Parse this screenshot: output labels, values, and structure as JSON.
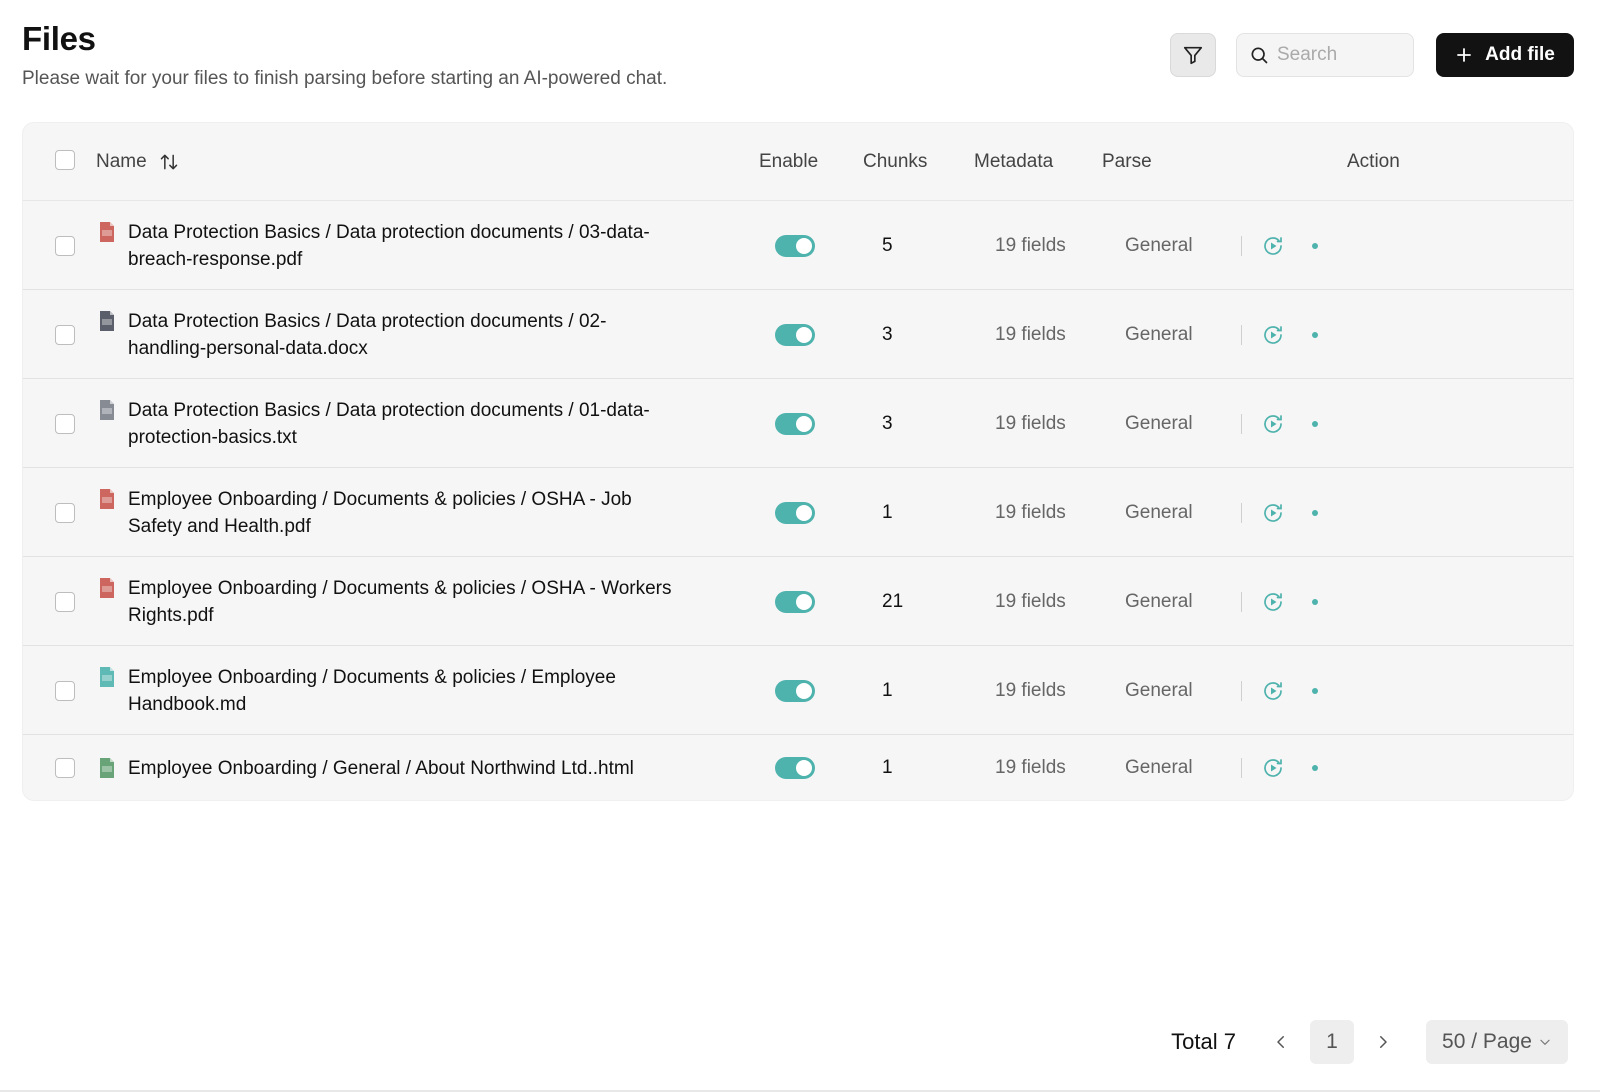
{
  "header": {
    "title": "Files",
    "subtitle": "Please wait for your files to finish parsing before starting an AI-powered chat."
  },
  "toolbar": {
    "filter_icon": "filter-icon",
    "search_placeholder": "Search",
    "add_label": "Add file"
  },
  "table": {
    "columns": {
      "name": "Name",
      "enable": "Enable",
      "chunks": "Chunks",
      "metadata": "Metadata",
      "parse": "Parse",
      "action": "Action"
    },
    "rows": [
      {
        "name_line1": "Data Protection Basics / Data protection documents / 03-data-",
        "name_line2": "breach-response.pdf",
        "type": "pdf",
        "enabled": true,
        "chunks": "5",
        "metadata": "19 fields",
        "parse": "General"
      },
      {
        "name_line1": "Data Protection Basics / Data protection documents / 02-",
        "name_line2": "handling-personal-data.docx",
        "type": "docx",
        "enabled": true,
        "chunks": "3",
        "metadata": "19 fields",
        "parse": "General"
      },
      {
        "name_line1": "Data Protection Basics / Data protection documents / 01-data-",
        "name_line2": "protection-basics.txt",
        "type": "txt",
        "enabled": true,
        "chunks": "3",
        "metadata": "19 fields",
        "parse": "General"
      },
      {
        "name_line1": "Employee Onboarding / Documents & policies / OSHA - Job",
        "name_line2": "Safety and Health.pdf",
        "type": "pdf",
        "enabled": true,
        "chunks": "1",
        "metadata": "19 fields",
        "parse": "General"
      },
      {
        "name_line1": "Employee Onboarding / Documents & policies / OSHA - Workers",
        "name_line2": "Rights.pdf",
        "type": "pdf",
        "enabled": true,
        "chunks": "21",
        "metadata": "19 fields",
        "parse": "General"
      },
      {
        "name_line1": "Employee Onboarding / Documents & policies / Employee",
        "name_line2": "Handbook.md",
        "type": "md",
        "enabled": true,
        "chunks": "1",
        "metadata": "19 fields",
        "parse": "General"
      },
      {
        "name_line1": "Employee Onboarding / General / About Northwind Ltd..html",
        "name_line2": "",
        "type": "html",
        "enabled": true,
        "chunks": "1",
        "metadata": "19 fields",
        "parse": "General"
      }
    ]
  },
  "pagination": {
    "total": "Total 7",
    "current_page": "1",
    "page_size": "50 / Page"
  },
  "colors": {
    "accent": "#4fb3ad",
    "pdf": "#c9574f",
    "docx": "#4a4f5c",
    "txt": "#7a7f8a",
    "md": "#4fb3ad",
    "html": "#5a9a6a"
  }
}
